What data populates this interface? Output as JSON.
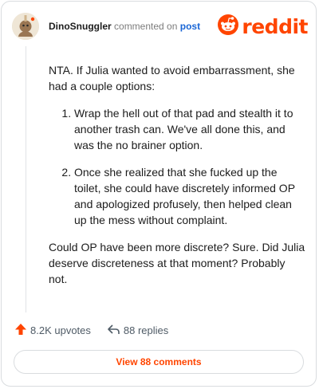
{
  "header": {
    "username": "DinoSnuggler",
    "verb": "commented on",
    "target": "post",
    "avatar_icon": "dino-avatar-icon",
    "logo_text": "reddit",
    "logo_icon": "reddit-snoo-icon"
  },
  "comment": {
    "intro": "NTA. If Julia wanted to avoid embarrassment, she had a couple options:",
    "options": [
      "Wrap the hell out of that pad and stealth it to another trash can. We've all done this, and was the no brainer option.",
      "Once she realized that she fucked up the toilet, she could have discretely informed OP and apologized profusely, then helped clean up the mess without complaint."
    ],
    "closing": "Could OP have been more discrete? Sure. Did Julia deserve discreteness at that moment? Probably not."
  },
  "actions": {
    "upvotes": "8.2K upvotes",
    "upvote_icon": "upvote-arrow-icon",
    "replies": "88 replies",
    "reply_icon": "reply-arrow-icon"
  },
  "view_button": "View 88 comments",
  "colors": {
    "brand": "#ff4500",
    "link": "#1a66d6",
    "muted": "#7c7c7c",
    "border": "#d9dcdf"
  }
}
